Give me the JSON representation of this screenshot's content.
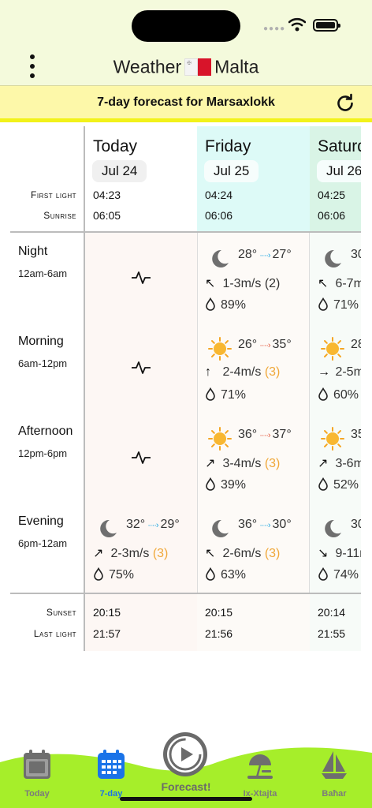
{
  "header": {
    "title_left": "Weather",
    "title_right": "Malta",
    "flag": "malta-flag"
  },
  "banner": {
    "text": "7-day forecast for Marsaxlokk",
    "refresh_icon": "refresh-icon"
  },
  "labels": {
    "first_light": "First light",
    "sunrise": "Sunrise",
    "sunset": "Sunset",
    "last_light": "Last light"
  },
  "periods": [
    {
      "name": "Night",
      "range": "12am-6am"
    },
    {
      "name": "Morning",
      "range": "6am-12pm"
    },
    {
      "name": "Afternoon",
      "range": "12pm-6pm"
    },
    {
      "name": "Evening",
      "range": "6pm-12am"
    }
  ],
  "days": [
    {
      "name": "Today",
      "date": "Jul 24",
      "first_light": "04:23",
      "sunrise": "06:05",
      "sunset": "20:15",
      "last_light": "21:57",
      "slots": [
        {
          "empty": true,
          "icon": "activity-icon"
        },
        {
          "empty": true,
          "icon": "activity-icon"
        },
        {
          "empty": true,
          "icon": "activity-icon"
        },
        {
          "icon": "moon-icon",
          "from": "32°",
          "to": "29°",
          "trend": "cold",
          "dir": "↗",
          "wind": "2-3m/s",
          "gust": "(3)",
          "rain": "75%"
        }
      ]
    },
    {
      "name": "Friday",
      "date": "Jul 25",
      "first_light": "04:24",
      "sunrise": "06:06",
      "sunset": "20:15",
      "last_light": "21:56",
      "slots": [
        {
          "icon": "moon-icon",
          "from": "28°",
          "to": "27°",
          "trend": "cold",
          "dir": "↖",
          "wind": "1-3m/s",
          "gust": "(2)",
          "rain": "89%"
        },
        {
          "icon": "sun-icon",
          "from": "26°",
          "to": "35°",
          "trend": "warm",
          "dir": "↑",
          "wind": "2-4m/s",
          "gust": "(3)",
          "rain": "71%"
        },
        {
          "icon": "sun-icon",
          "from": "36°",
          "to": "37°",
          "trend": "warm",
          "dir": "↗",
          "wind": "3-4m/s",
          "gust": "(3)",
          "rain": "39%"
        },
        {
          "icon": "moon-icon",
          "from": "36°",
          "to": "30°",
          "trend": "cold",
          "dir": "↖",
          "wind": "2-6m/s",
          "gust": "(3)",
          "rain": "63%"
        }
      ]
    },
    {
      "name": "Saturd",
      "date": "Jul 26",
      "first_light": "04:25",
      "sunrise": "06:06",
      "sunset": "20:14",
      "last_light": "21:55",
      "slots": [
        {
          "icon": "moon-icon",
          "from": "30",
          "to": "",
          "trend": "cold",
          "dir": "↖",
          "wind": "6-7m",
          "gust": "",
          "rain": "71%"
        },
        {
          "icon": "sun-icon",
          "from": "28",
          "to": "",
          "trend": "warm",
          "dir": "→",
          "wind": "2-5m",
          "gust": "",
          "rain": "60%"
        },
        {
          "icon": "sun-icon",
          "from": "35",
          "to": "",
          "trend": "warm",
          "dir": "↗",
          "wind": "3-6m",
          "gust": "",
          "rain": "52%"
        },
        {
          "icon": "moon-icon",
          "from": "30",
          "to": "",
          "trend": "cold",
          "dir": "↘",
          "wind": "9-11m",
          "gust": "",
          "rain": "74%"
        }
      ]
    }
  ],
  "tabs": [
    {
      "label": "Today",
      "icon": "calendar-day-icon",
      "active": false
    },
    {
      "label": "7-day",
      "icon": "calendar-week-icon",
      "active": true
    },
    {
      "label": "Ix-Xtajta",
      "icon": "beach-umbrella-icon",
      "active": false
    },
    {
      "label": "Baħar",
      "icon": "sailboat-icon",
      "active": false
    }
  ],
  "forecast_button": {
    "label": "Forecast!",
    "icon": "play-circle-icon"
  },
  "colors": {
    "header_bg": "#f4fadc",
    "banner_bg": "#fdf8a9",
    "banner_line": "#f2f21a",
    "today_head": "#ffffff",
    "friday_head": "#ddfaf7",
    "saturday_head": "#d9f4e6",
    "tab_active": "#1a73e8",
    "hill_green": "#a6ee2a",
    "cold_arrow": "#21a7e0",
    "warm_arrow": "#e2563a",
    "gust": "#f0a83a"
  }
}
